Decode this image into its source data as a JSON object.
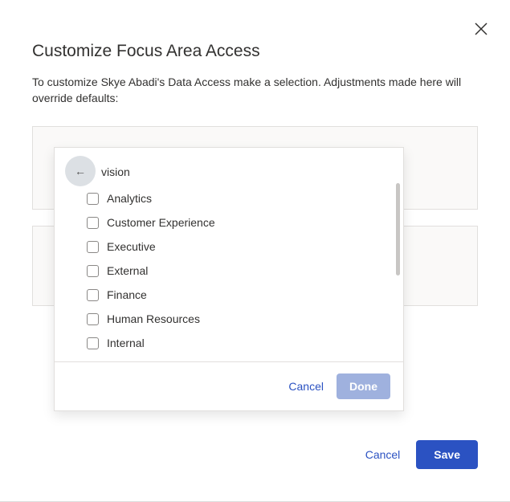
{
  "dialog": {
    "title": "Customize Focus Area Access",
    "description": "To customize Skye Abadi's Data Access make a selection. Adjustments made here will override defaults:"
  },
  "footer": {
    "cancel": "Cancel",
    "save": "Save"
  },
  "popover": {
    "section_label": "vision",
    "options": [
      {
        "label": "Analytics"
      },
      {
        "label": "Customer Experience"
      },
      {
        "label": "Executive"
      },
      {
        "label": "External"
      },
      {
        "label": "Finance"
      },
      {
        "label": "Human Resources"
      },
      {
        "label": "Internal"
      }
    ],
    "cancel": "Cancel",
    "done": "Done"
  }
}
